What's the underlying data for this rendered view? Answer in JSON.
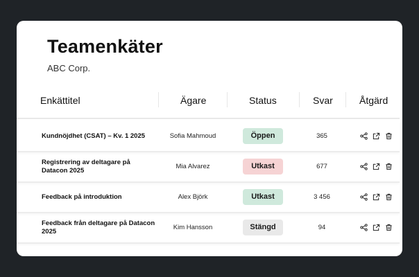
{
  "header": {
    "title": "Teamenkäter",
    "subtitle": "ABC Corp."
  },
  "table": {
    "columns": [
      "Enkättitel",
      "Ägare",
      "Status",
      "Svar",
      "Åtgärd"
    ],
    "rows": [
      {
        "title": "Kundnöjdhet (CSAT) – Kv. 1 2025",
        "owner": "Sofia Mahmoud",
        "status": "Öppen",
        "status_color": "#cfe9dc",
        "responses": "365"
      },
      {
        "title": "Registrering av deltagare på Datacon 2025",
        "owner": "Mia Alvarez",
        "status": "Utkast",
        "status_color": "#f6d3d4",
        "responses": "677"
      },
      {
        "title": "Feedback på introduktion",
        "owner": "Alex Björk",
        "status": "Utkast",
        "status_color": "#cfe9dc",
        "responses": "3 456"
      },
      {
        "title": "Feedback från deltagare på Datacon 2025",
        "owner": "Kim Hansson",
        "status": "Stängd",
        "status_color": "#e9e9e9",
        "responses": "94"
      }
    ],
    "action_icons": [
      "share-icon",
      "export-icon",
      "trash-icon"
    ]
  },
  "colors": {
    "background": "#1f2327",
    "card": "#ffffff",
    "text": "#111111"
  }
}
